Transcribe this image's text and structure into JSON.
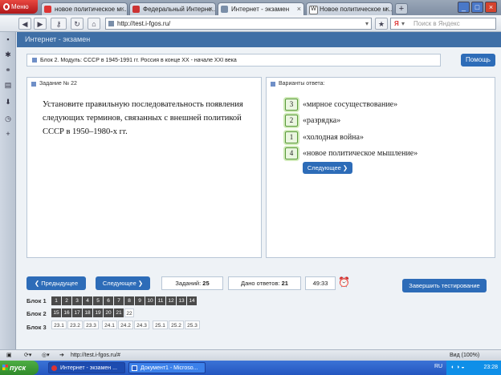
{
  "browser": {
    "menu_label": "Меню",
    "tabs": [
      {
        "label": "новое политическое м..."
      },
      {
        "label": "Федеральный Интерне..."
      },
      {
        "label": "Интернет - экзамен"
      },
      {
        "label": "Новое политическое м..."
      }
    ],
    "address": "http://test.i-fgos.ru/",
    "search_placeholder": "Поиск в Яндекс"
  },
  "page": {
    "header": "Интернет - экзамен",
    "breadcrumb": "Блок 2. Модуль: СССР в 1945-1991 гг. Россия в конце XX - начале XXI века",
    "help_label": "Помощь",
    "task": {
      "title": "Задание № 22",
      "text": "Установите правильную последовательность появления следующих терминов, связанных с внешней политикой СССР в 1950–1980-х гг."
    },
    "answers": {
      "title": "Варианты ответа:",
      "options": [
        {
          "num": "3",
          "text": "«мирное сосуществование»"
        },
        {
          "num": "2",
          "text": "«разрядка»"
        },
        {
          "num": "1",
          "text": "«холодная война»"
        },
        {
          "num": "4",
          "text": "«новое политическое мышление»"
        }
      ],
      "next_label": "Следующее"
    },
    "nav": {
      "prev_label": "Предыдущее",
      "next_label": "Следующее",
      "tasks_label": "Заданий:",
      "tasks_value": "25",
      "answered_label": "Дано ответов:",
      "answered_value": "21",
      "timer": "49:33",
      "finish_label": "Завершить тестирование"
    },
    "blocks": [
      {
        "label": "Блок 1",
        "items": [
          "1",
          "2",
          "3",
          "4",
          "5",
          "6",
          "7",
          "8",
          "9",
          "10",
          "11",
          "12",
          "13",
          "14"
        ],
        "answered": 14
      },
      {
        "label": "Блок 2",
        "items": [
          "15",
          "16",
          "17",
          "18",
          "19",
          "20",
          "21",
          "22"
        ],
        "answered": 7
      },
      {
        "label": "Блок 3",
        "items": [
          "23.1",
          "23.2",
          "23.3",
          "24.1",
          "24.2",
          "24.3",
          "25.1",
          "25.2",
          "25.3"
        ],
        "answered": 0
      }
    ]
  },
  "statusbar": {
    "url": "http://test.i-fgos.ru/#",
    "zoom": "Вид (100%)"
  },
  "taskbar": {
    "start_label": "пуск",
    "tasks": [
      {
        "label": "Интернет - экзамен ..."
      },
      {
        "label": "Документ1 - Microso..."
      }
    ],
    "lang": "RU",
    "clock": "23:28"
  },
  "colors": {
    "header_blue": "#3f6fa6",
    "button_blue": "#2d6cb8",
    "block_dark": "#4a4a4a",
    "answer_green": "#5a9a3a"
  }
}
